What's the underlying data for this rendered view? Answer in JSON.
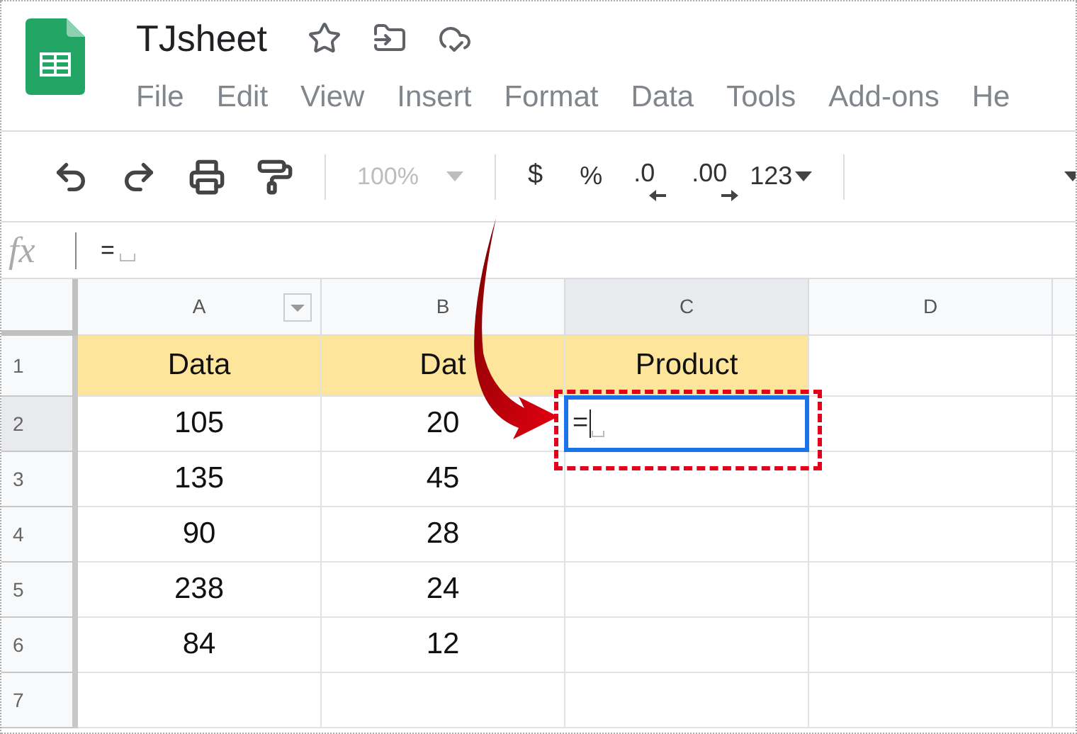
{
  "document": {
    "title": "TJsheet"
  },
  "menu": [
    "File",
    "Edit",
    "View",
    "Insert",
    "Format",
    "Data",
    "Tools",
    "Add-ons",
    "He"
  ],
  "toolbar": {
    "zoom": "100%",
    "zoom_disabled": true,
    "currency": "$",
    "percent": "%",
    "decrease_decimals": ".0",
    "increase_decimals": ".00",
    "number_format": "123"
  },
  "formula_bar": {
    "label": "fx",
    "value": "="
  },
  "columns": [
    {
      "label": "A",
      "selected": false,
      "filter": true
    },
    {
      "label": "B",
      "selected": false,
      "filter": false
    },
    {
      "label": "C",
      "selected": true,
      "filter": false
    },
    {
      "label": "D",
      "selected": false,
      "filter": false
    }
  ],
  "rows": [
    {
      "number": "1",
      "selected": false,
      "highlighted": true,
      "cells": [
        {
          "text": "Data",
          "editing": false
        },
        {
          "text": "Dat",
          "editing": false
        },
        {
          "text": "Product",
          "editing": false
        }
      ]
    },
    {
      "number": "2",
      "selected": true,
      "highlighted": false,
      "cells": [
        {
          "text": "105",
          "editing": false
        },
        {
          "text": "20",
          "editing": false
        },
        {
          "text": "=",
          "editing": true
        }
      ]
    },
    {
      "number": "3",
      "selected": false,
      "highlighted": false,
      "cells": [
        {
          "text": "135",
          "editing": false
        },
        {
          "text": "45",
          "editing": false
        }
      ]
    },
    {
      "number": "4",
      "selected": false,
      "highlighted": false,
      "cells": [
        {
          "text": "90",
          "editing": false
        },
        {
          "text": "28",
          "editing": false
        }
      ]
    },
    {
      "number": "5",
      "selected": false,
      "highlighted": false,
      "cells": [
        {
          "text": "238",
          "editing": false
        },
        {
          "text": "24",
          "editing": false
        }
      ]
    },
    {
      "number": "6",
      "selected": false,
      "highlighted": false,
      "cells": [
        {
          "text": "84",
          "editing": false
        },
        {
          "text": "12",
          "editing": false
        }
      ]
    },
    {
      "number": "7",
      "selected": false,
      "highlighted": false,
      "cells": []
    }
  ],
  "annotation": {
    "arrow": true,
    "highlight_box": true
  }
}
